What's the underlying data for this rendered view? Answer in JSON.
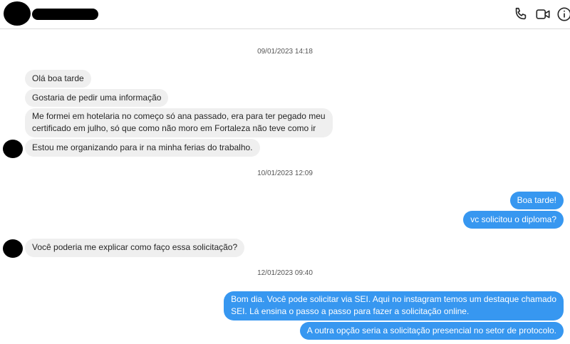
{
  "header": {
    "contact_avatar": "redacted",
    "contact_name": "redacted",
    "icons": [
      "phone-icon",
      "video-icon",
      "info-icon"
    ]
  },
  "timestamps": {
    "t1": "09/01/2023 14:18",
    "t2": "10/01/2023 12:09",
    "t3": "12/01/2023 09:40"
  },
  "messages": [
    {
      "sender": "them",
      "text": "Olá boa tarde"
    },
    {
      "sender": "them",
      "text": "Gostaria de pedir uma informação"
    },
    {
      "sender": "them",
      "line1": "Me formei em hotelaria no começo só ana passado, era para ter pegado meu",
      "line2": "certificado em julho, só que como não moro em Fortaleza não teve como ir"
    },
    {
      "sender": "them",
      "text": "Estou me organizando para ir na minha ferias do trabalho."
    },
    {
      "sender": "me",
      "text": "Boa tarde!"
    },
    {
      "sender": "me",
      "text": "vc solicitou o diploma?"
    },
    {
      "sender": "them",
      "text": "Você poderia me explicar como faço essa solicitação?"
    },
    {
      "sender": "me",
      "line1": "Bom dia. Você pode solicitar via SEI. Aqui no instagram temos um destaque chamado",
      "line2": "SEI. Lá ensina o passo a passo para fazer a solicitação online."
    },
    {
      "sender": "me",
      "text": "A outra opção seria a solicitação presencial no setor de protocolo."
    }
  ],
  "colors": {
    "outgoing_bubble": "#3797f0",
    "incoming_bubble": "#efefef"
  }
}
